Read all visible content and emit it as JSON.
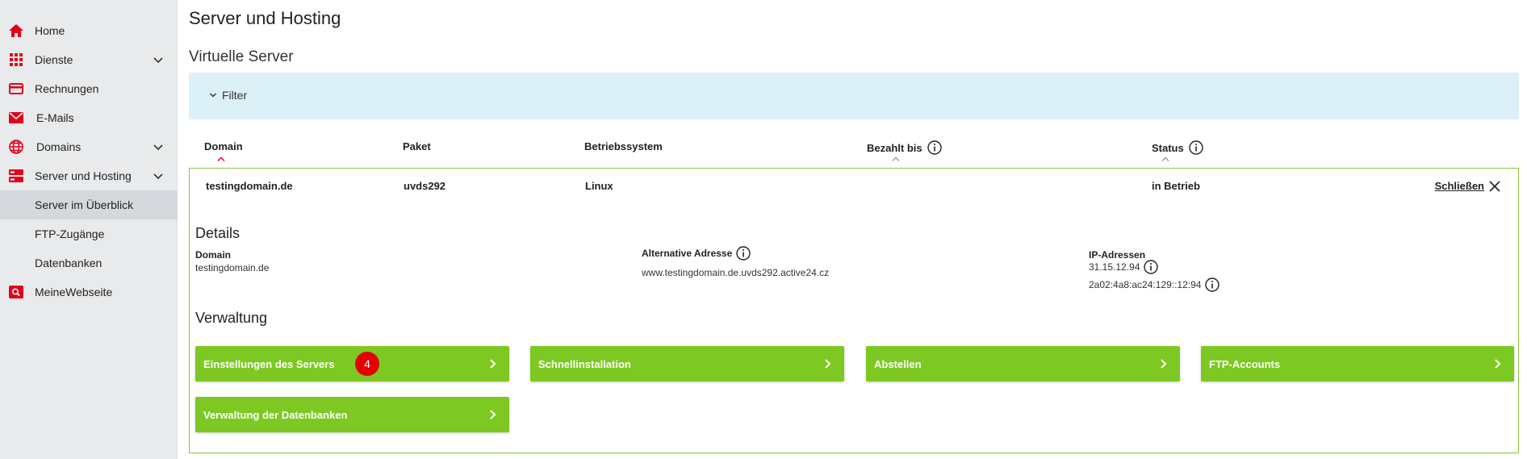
{
  "colors": {
    "brand_red": "#e2001a",
    "accent_green": "#7ec823",
    "filter_bg": "#dcf0f7",
    "sidebar_bg": "#e8eaec"
  },
  "sidebar": {
    "items": [
      {
        "label": "Home",
        "icon": "home-icon"
      },
      {
        "label": "Dienste",
        "icon": "grid-icon",
        "expandable": true
      },
      {
        "label": "Rechnungen",
        "icon": "credit-card-icon"
      },
      {
        "label": "E-Mails",
        "icon": "envelope-icon"
      },
      {
        "label": "Domains",
        "icon": "globe-icon",
        "expandable": true
      },
      {
        "label": "Server und Hosting",
        "icon": "server-icon",
        "expandable": true,
        "expanded": true
      },
      {
        "label": "Server im Überblick",
        "sub": true,
        "active": true
      },
      {
        "label": "FTP-Zugänge",
        "sub": true
      },
      {
        "label": "Datenbanken",
        "sub": true
      },
      {
        "label": "MeineWebseite",
        "icon": "website-search-icon"
      }
    ]
  },
  "page": {
    "title": "Server und Hosting",
    "subtitle": "Virtuelle Server"
  },
  "filter": {
    "label": "Filter"
  },
  "table": {
    "headers": {
      "domain": "Domain",
      "paket": "Paket",
      "betriebssystem": "Betriebssystem",
      "bezahlt_bis": "Bezahlt bis",
      "status": "Status"
    },
    "row": {
      "domain": "testingdomain.de",
      "paket": "uvds292",
      "betriebssystem": "Linux",
      "status": "in Betrieb",
      "close_label": "Schließen"
    }
  },
  "details": {
    "title": "Details",
    "domain_label": "Domain",
    "domain_value": "testingdomain.de",
    "alt_label": "Alternative Adresse",
    "alt_value": "www.testingdomain.de.uvds292.active24.cz",
    "ip_label": "IP-Adressen",
    "ipv4": "31.15.12.94",
    "ipv6": "2a02:4a8:ac24:129::12:94"
  },
  "verwaltung": {
    "title": "Verwaltung",
    "buttons": [
      {
        "label": "Einstellungen des Servers",
        "badge": "4"
      },
      {
        "label": "Schnellinstallation"
      },
      {
        "label": "Abstellen"
      },
      {
        "label": "FTP-Accounts"
      },
      {
        "label": "Verwaltung der Datenbanken"
      }
    ]
  }
}
